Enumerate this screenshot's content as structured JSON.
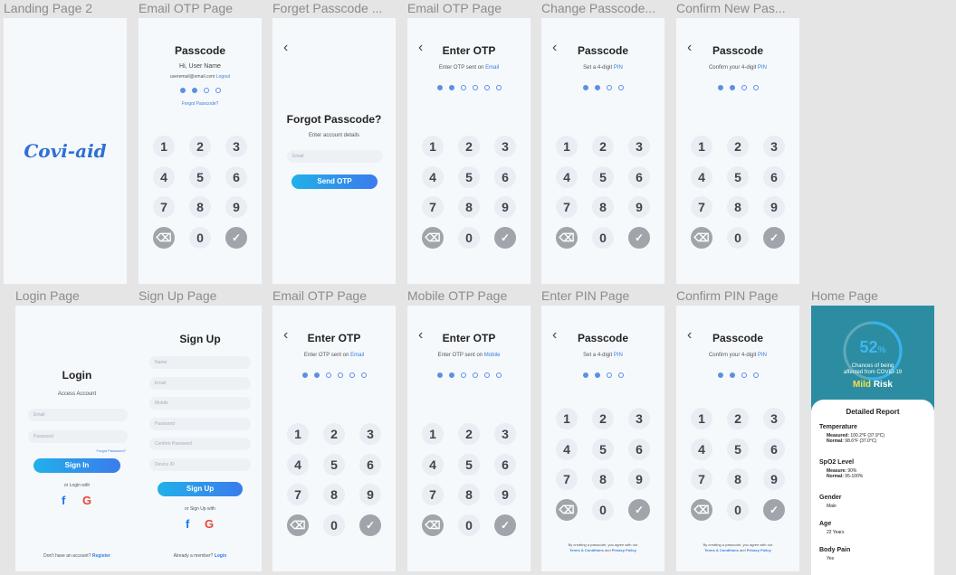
{
  "labels": {
    "landing2": "Landing Page 2",
    "email_otp_top": "Email OTP Page",
    "forget": "Forget Passcode ...",
    "email_otp_top2": "Email OTP Page",
    "change": "Change Passcode...",
    "confirm_new": "Confirm New Pas...",
    "login": "Login Page",
    "signup": "Sign Up Page",
    "email_otp_bottom": "Email OTP Page",
    "mobile_otp": "Mobile OTP Page",
    "enter_pin": "Enter PIN Page",
    "confirm_pin": "Confirm PIN Page",
    "home": "Home Page"
  },
  "brand": "Covi-aid",
  "keypad": [
    "1",
    "2",
    "3",
    "4",
    "5",
    "6",
    "7",
    "8",
    "9",
    "⌫",
    "0",
    "✓"
  ],
  "passcode": {
    "title": "Passcode",
    "greet": "Hi, User Name",
    "email": "useremail@email.com",
    "logout": "Logout",
    "forgot": "Forgot Passcode?"
  },
  "forgot_page": {
    "back": "‹",
    "title": "Forgot Passcode?",
    "sub": "Enter account details",
    "email_ph": "Email",
    "button": "Send OTP"
  },
  "otp": {
    "title": "Enter OTP",
    "sent_email_a": "Enter OTP sent on ",
    "email": "Email",
    "sent_mobile_a": "Enter OTP sent on ",
    "mobile": "Mobile"
  },
  "change": {
    "title": "Passcode",
    "sub_a": "Set a 4-digit ",
    "pin": "PIN"
  },
  "confirm": {
    "title": "Passcode",
    "sub_a": "Confirm your 4-digit ",
    "pin": "PIN"
  },
  "terms": {
    "line1": "By creating a passcode, you agree with our",
    "tc": "Terms & Conditions",
    "and": " and ",
    "pp": "Privacy Policy"
  },
  "login": {
    "title": "Login",
    "sub": "Access Account",
    "email_ph": "Email",
    "password_ph": "Password",
    "forgot": "Forgot Password?",
    "button": "Sign In",
    "or": "or Login with",
    "no_account": "Don't have an account? ",
    "register": "Register"
  },
  "signup": {
    "title": "Sign Up",
    "fields": [
      "Name",
      "Email",
      "Mobile",
      "Password",
      "Confirm Password",
      "Device ID"
    ],
    "button": "Sign Up",
    "or": "or Sign Up with",
    "member": "Already a member? ",
    "login": "Login"
  },
  "home": {
    "percent": "52",
    "percent_sign": "%",
    "progress": 0.52,
    "chance_1": "Chances of being",
    "chance_2": "affected from COVID-19",
    "risk_a": "Mild",
    "risk_b": " Risk",
    "report_title": "Detailed Report",
    "temp_h": "Temperature",
    "temp_m_l": "Measured:",
    "temp_m": " 100.2°F (37.9°C)",
    "temp_n_l": "Normal:",
    "temp_n": " 98.6°F (37.0°C)",
    "spo2_h": "SpO2 Level",
    "spo2_m_l": "Measure:",
    "spo2_m": " 90%",
    "spo2_n_l": "Normal:",
    "spo2_n": " 95-100%",
    "gender_h": "Gender",
    "gender": "Male",
    "age_h": "Age",
    "age": "22 Years",
    "pain_h": "Body Pain",
    "pain": "Yes"
  },
  "colors": {
    "accent": "#3a7be0",
    "risk": "#f4e04d",
    "home_bg": "#2c8da2"
  }
}
